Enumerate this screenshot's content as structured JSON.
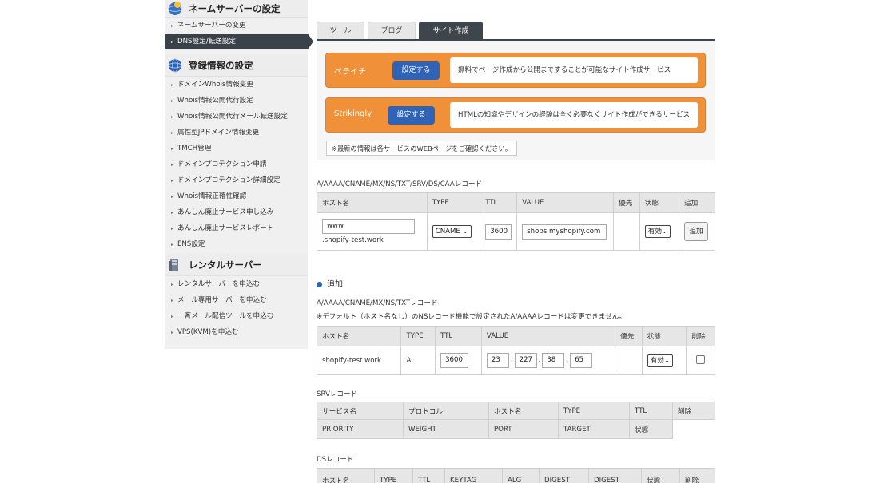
{
  "sidebar": {
    "sections": [
      {
        "title": "ネームサーバーの設定",
        "icon": "nameserver-globe-icon",
        "items": [
          {
            "label": "ネームサーバーの変更",
            "active": false
          },
          {
            "label": "DNS設定/転送設定",
            "active": true
          }
        ]
      },
      {
        "title": "登録情報の設定",
        "icon": "registration-globe-icon",
        "items": [
          {
            "label": "ドメインWhois情報変更"
          },
          {
            "label": "Whois情報公開代行設定"
          },
          {
            "label": "Whois情報公開代行メール転送設定"
          },
          {
            "label": "属性型JPドメイン情報変更"
          },
          {
            "label": "TMCH管理"
          },
          {
            "label": "ドメインプロテクション申請"
          },
          {
            "label": "ドメインプロテクション詳細設定"
          },
          {
            "label": "Whois情報正確性確認"
          },
          {
            "label": "あんしん廃止サービス申し込み"
          },
          {
            "label": "あんしん廃止サービスレポート"
          },
          {
            "label": "ENS設定"
          }
        ]
      },
      {
        "title": "レンタルサーバー",
        "icon": "server-icon",
        "items": [
          {
            "label": "レンタルサーバーを申込む"
          },
          {
            "label": "メール専用サーバーを申込む"
          },
          {
            "label": "一斉メール配信ツールを申込む"
          },
          {
            "label": "VPS(KVM)を申込む"
          }
        ]
      }
    ]
  },
  "tabs": [
    {
      "label": "ツール",
      "active": false
    },
    {
      "label": "ブログ",
      "active": false
    },
    {
      "label": "サイト作成",
      "active": true
    }
  ],
  "services": [
    {
      "name": "ペライチ",
      "button": "設定する",
      "description": "無料でページ作成から公開まですることが可能なサイト作成サービス"
    },
    {
      "name": "Strikingly",
      "button": "設定する",
      "description": "HTMLの知識やデザインの経験は全く必要なくサイト作成ができるサービス"
    }
  ],
  "notice": "※最新の情報は各サービスのWEBページをご確認ください。",
  "add_record": {
    "title": "A/AAAA/CNAME/MX/NS/TXT/SRV/DS/CAAレコード",
    "headers": [
      "ホスト名",
      "TYPE",
      "TTL",
      "VALUE",
      "優先",
      "状態",
      "追加"
    ],
    "host_value": "www",
    "host_suffix": ".shopify-test.work",
    "type": "CNAME",
    "ttl": "3600",
    "value": "shops.myshopify.com",
    "priority": "",
    "status": "有効",
    "add_button": "追加"
  },
  "added": {
    "heading": "追加",
    "title": "A/AAAA/CNAME/MX/NS/TXTレコード",
    "note": "※デフォルト（ホスト名なし）のNSレコード機能で設定されたA/AAAAレコードは変更できません。",
    "headers": [
      "ホスト名",
      "TYPE",
      "TTL",
      "VALUE",
      "優先",
      "状態",
      "削除"
    ],
    "rows": [
      {
        "host": "shopify-test.work",
        "type": "A",
        "ttl": "3600",
        "ip": [
          "23",
          "227",
          "38",
          "65"
        ],
        "priority": "",
        "status": "有効"
      }
    ]
  },
  "srv": {
    "title": "SRVレコード",
    "headers_row1": [
      "サービス名",
      "プロトコル",
      "ホスト名",
      "TYPE",
      "TTL",
      "削除"
    ],
    "headers_row2": [
      "PRIORITY",
      "WEIGHT",
      "PORT",
      "TARGET",
      "状態"
    ]
  },
  "ds": {
    "title": "DSレコード",
    "headers": [
      "ホスト名",
      "TYPE",
      "TTL",
      "KEYTAG",
      "ALG",
      "DIGEST",
      "DIGEST",
      "状態",
      "削除"
    ]
  },
  "colors": {
    "accent_orange": "#f0913a",
    "button_blue": "#2f63b6",
    "active_dark": "#3e454d"
  }
}
